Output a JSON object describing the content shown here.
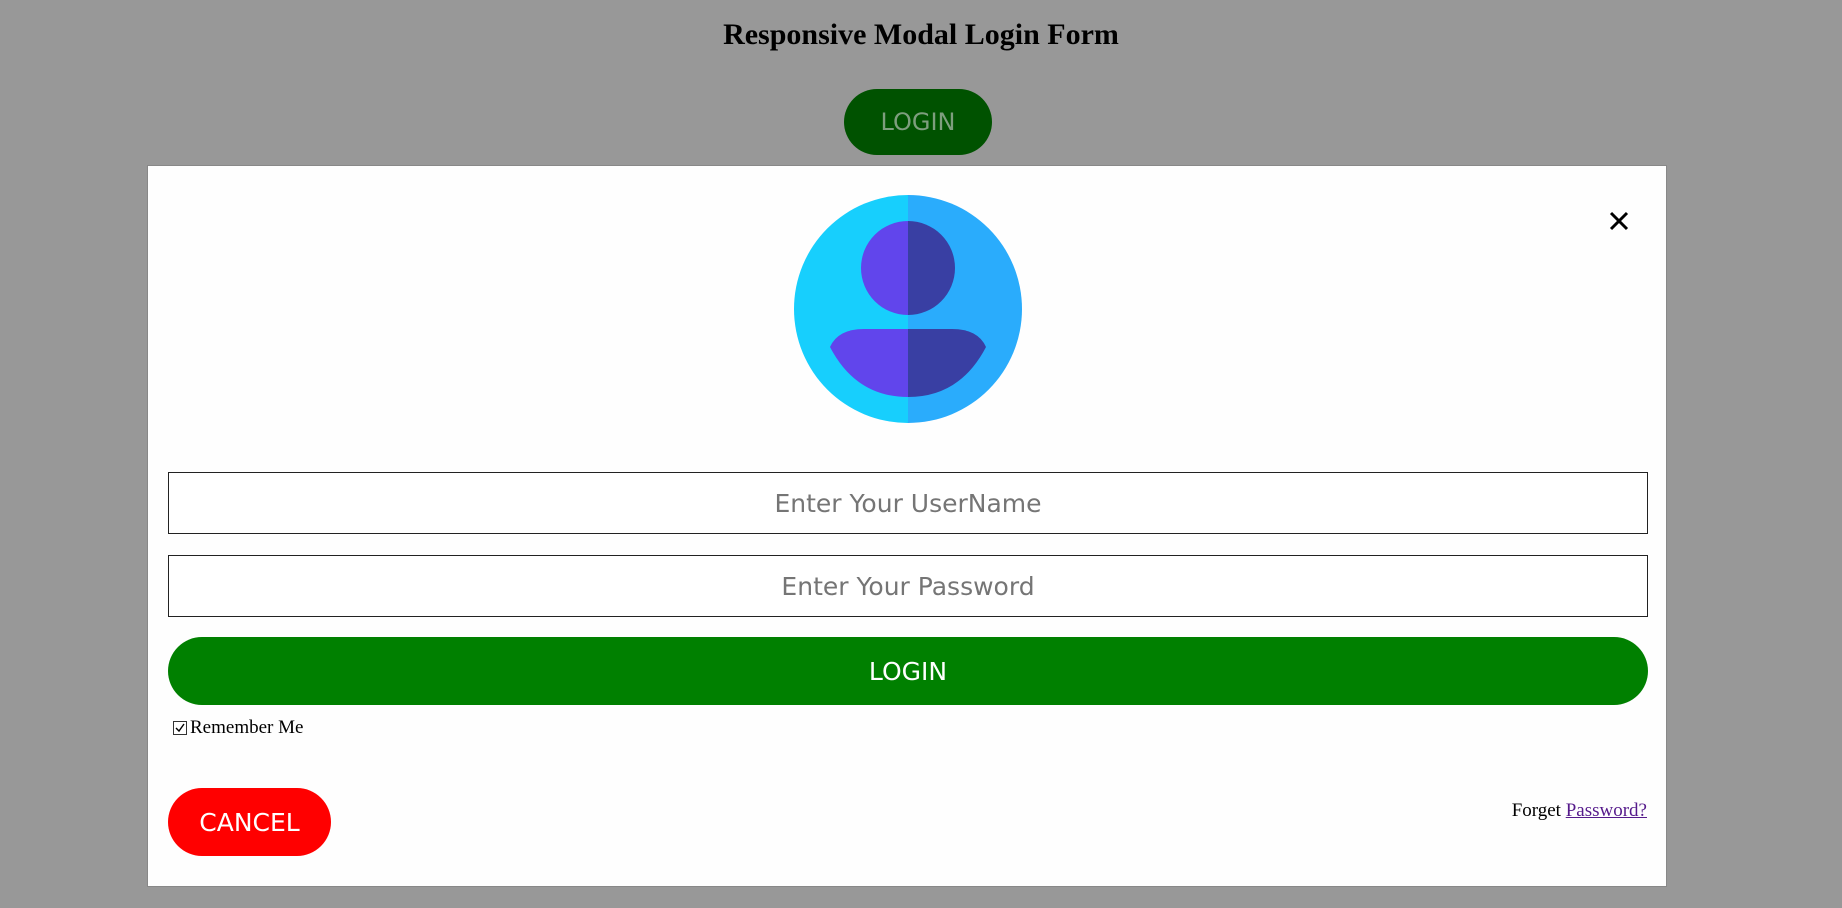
{
  "page": {
    "title": "Responsive Modal Login Form",
    "open_button_label": "LOGIN"
  },
  "modal": {
    "close_icon": "close-icon",
    "avatar_icon": "user-avatar-icon",
    "username": {
      "placeholder": "Enter Your UserName",
      "value": ""
    },
    "password": {
      "placeholder": "Enter Your Password",
      "value": ""
    },
    "submit_label": "LOGIN",
    "remember_label": "Remember Me",
    "remember_checked": true,
    "cancel_label": "CANCEL",
    "forget_prefix": "Forget",
    "forget_link": "Password?"
  },
  "colors": {
    "background": "#989898",
    "open_button_bg": "#005200",
    "submit_bg": "#008000",
    "cancel_bg": "#ff0000",
    "link": "#551a8b",
    "avatar_light": "#17cffd",
    "avatar_dark": "#2aacfc",
    "person_light": "#6145ec",
    "person_dark": "#393fa3"
  }
}
